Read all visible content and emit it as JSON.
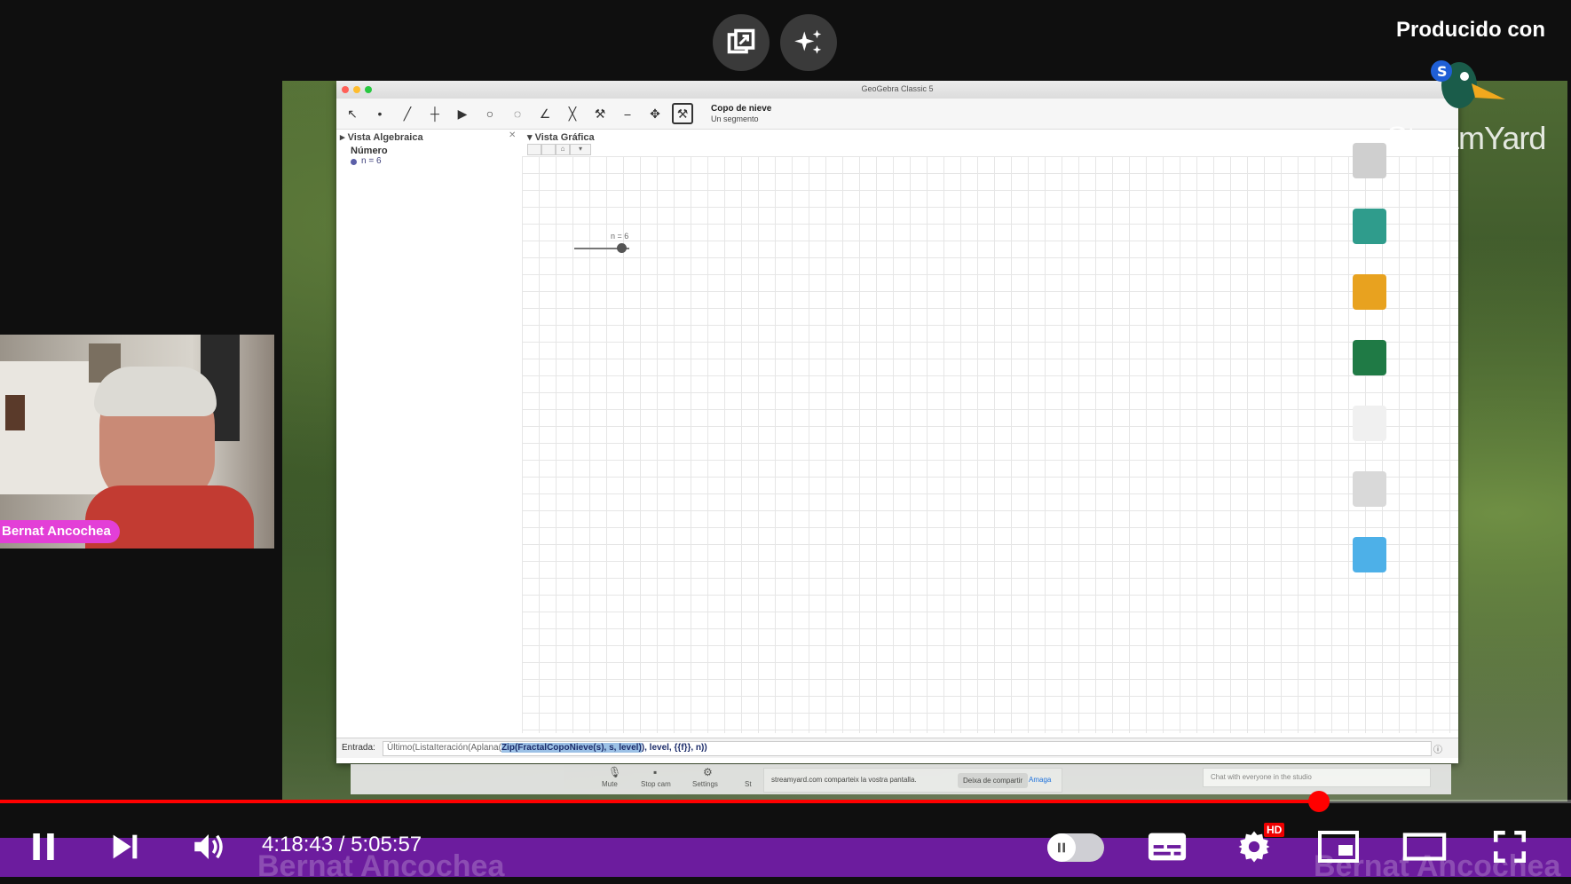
{
  "overlay": {
    "branding": "Producido con",
    "watermark": "StreamYard",
    "buttons": [
      "popout-icon",
      "sparkle-icon"
    ]
  },
  "geogebra": {
    "title": "GeoGebra Classic 5",
    "tool_name": "Copo de nieve",
    "tool_desc": "Un segmento",
    "algebra_view": {
      "header": "Vista Algebraica",
      "category": "Número",
      "item": "n = 6"
    },
    "graphics_view": {
      "header": "Vista Gráfica",
      "slider_label": "n = 6"
    },
    "input_bar": {
      "label": "Entrada:",
      "text_pre": "Último(ListaIteración(Aplana(",
      "text_hl": "Zip(FractalCopoNieve(s), s, level)",
      "text_post": "), level, {{f}}, n))"
    }
  },
  "streamyard_bar": {
    "tools": [
      "Mute",
      "Stop cam",
      "Settings",
      "St"
    ],
    "notice": "streamyard.com comparteix la vostra pantalla.",
    "stop_sharing": "Deixa de compartir",
    "hide": "Amaga",
    "chat_placeholder": "Chat with everyone in the studio"
  },
  "webcam": {
    "name": "Bernat Ancochea"
  },
  "player": {
    "time": "4:18:43 / 5:05:57",
    "progress": 0.8397,
    "ghost_text": "Bernat Ancochea",
    "hd_badge": "HD",
    "accent": "#ff0000",
    "bar_color": "#6c1c9e"
  },
  "colors": {
    "name_tag": "#e33fd7"
  }
}
